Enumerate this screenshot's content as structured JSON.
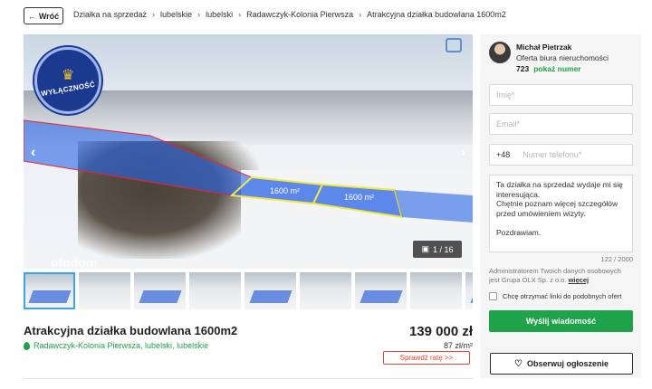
{
  "header": {
    "back_label": "Wróć",
    "breadcrumbs": [
      "Działka na sprzedaż",
      "lubelskie",
      "lubelski",
      "Radawczyk-Kolonia Pierwsza",
      "Atrakcyjna działka budowlana 1600m2"
    ]
  },
  "gallery": {
    "badge": "WYŁĄCZNOŚĆ",
    "plot_labels": [
      "1600 m²",
      "1600 m²"
    ],
    "counter": "1 / 16",
    "watermark": "otodom",
    "thumbnail_count": 9
  },
  "listing": {
    "title": "Atrakcyjna działka budowlana 1600m2",
    "location": "Radawczyk-Kolonia Pierwsza, lubelski, lubelskie",
    "price": "139 000 zł",
    "price_per_m2": "87 zł/m²",
    "rate_button": "Sprawdź ratę >>"
  },
  "contact": {
    "agent_name": "Michał Pietrzak",
    "agent_role": "Oferta biura nieruchomości",
    "phone_prefix_digits": "723",
    "show_number": "pokaż numer",
    "name_placeholder": "Imię*",
    "email_placeholder": "Email*",
    "phone_country": "+48",
    "phone_placeholder": "Numer telefonu*",
    "message": "Ta działka na sprzedaż wydaje mi się interesująca.\nChętnie poznam więcej szczegółów przed umówieniem wizyty.\n\nPozdrawiam.",
    "char_counter": "122 / 2000",
    "privacy_text": "Administratorem Twoich danych osobowych jest Grupa OLX Sp. z o.o.",
    "privacy_more": "więcej",
    "agree_label": "Chcę otrzymać linki do podobnych ofert",
    "send_button": "Wyślij wiadomość"
  },
  "watch_button": "Obserwuj ogłoszenie",
  "colors": {
    "accent_green": "#1fa34a",
    "plot_blue": "#3a6fe0",
    "badge_navy": "#1b3a8f",
    "rate_red": "#e0473a"
  }
}
